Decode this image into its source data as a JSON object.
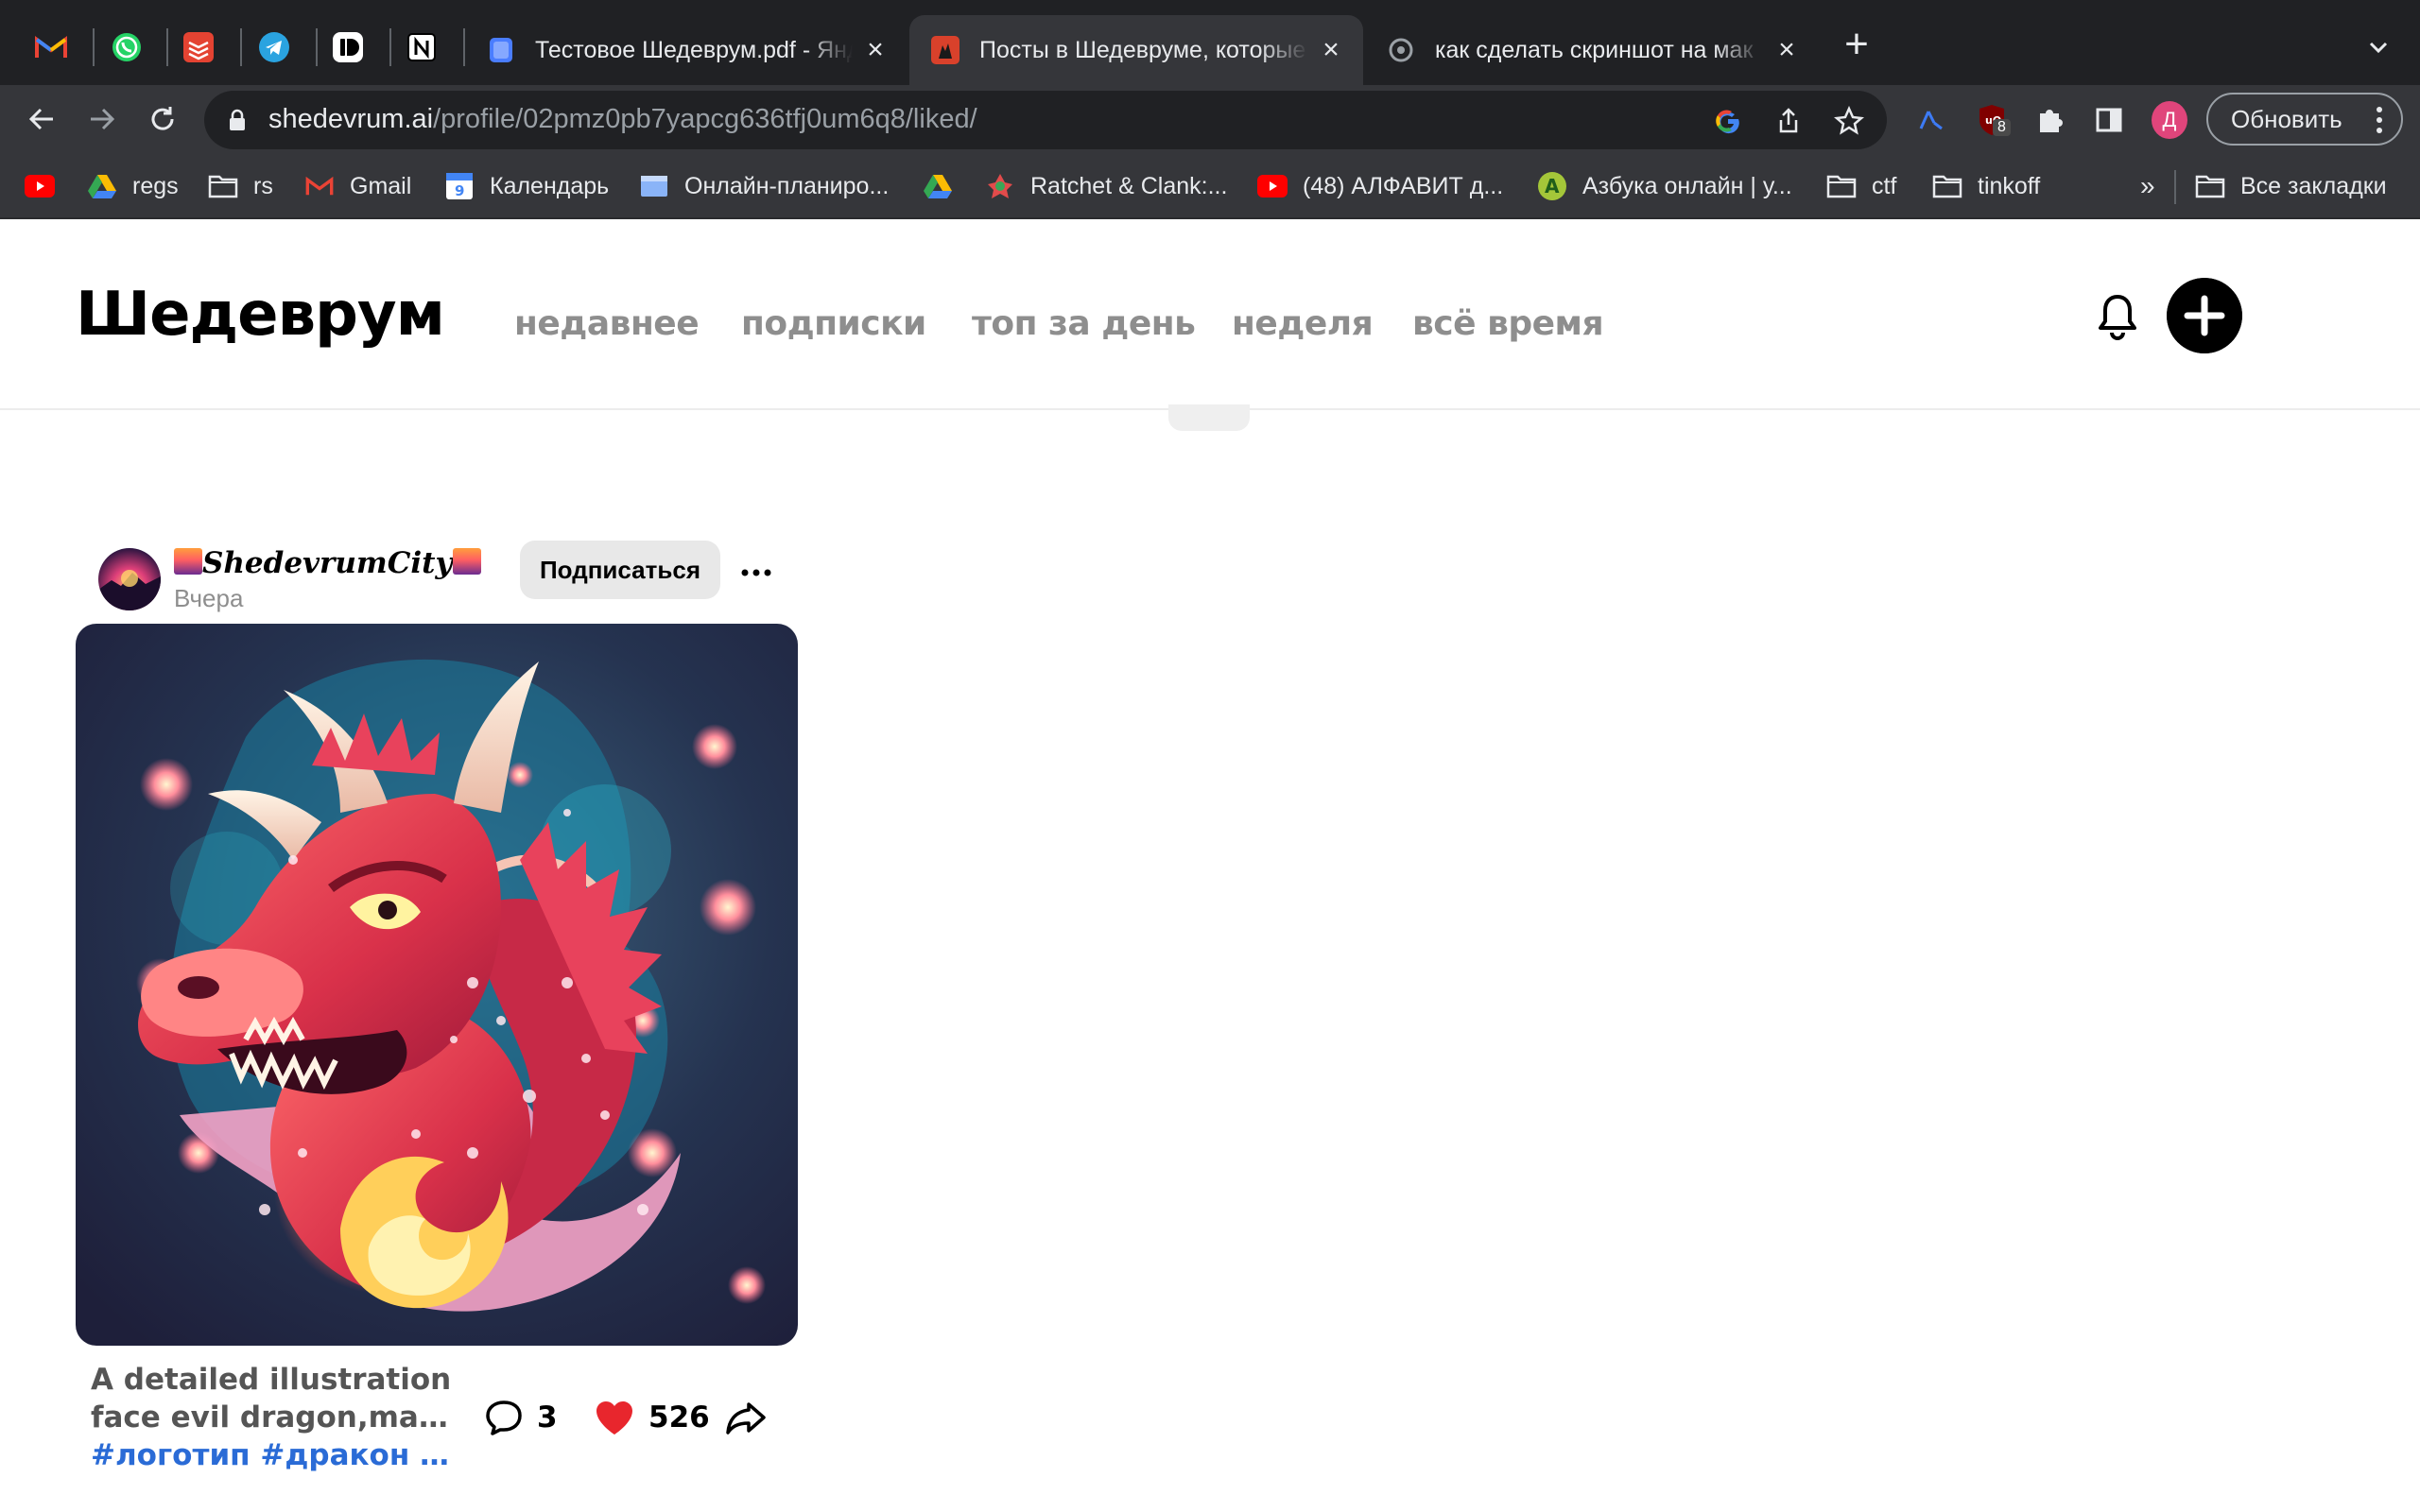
{
  "browser": {
    "pinned_tabs": [
      {
        "name": "gmail",
        "letter": "M"
      },
      {
        "name": "whatsapp",
        "letter": ""
      },
      {
        "name": "todoist",
        "letter": ""
      },
      {
        "name": "telegram",
        "letter": ""
      },
      {
        "name": "bear",
        "letter": ""
      },
      {
        "name": "notion",
        "letter": "N"
      }
    ],
    "tabs": [
      {
        "title": "Тестовое Шедеврум.pdf - Яндекс",
        "close": "×",
        "active": false
      },
      {
        "title": "Посты в Шедевруме, которые",
        "close": "×",
        "active": true
      },
      {
        "title": "как сделать скриншот на мак",
        "close": "×",
        "active": false
      }
    ],
    "new_tab": "+",
    "url_host": "shedevrum.ai",
    "url_path": "/profile/02pmz0pb7yapcg636tfj0um6q8/liked/",
    "update_label": "Обновить",
    "profile_letter": "Д",
    "extension_badge": "8",
    "bookmarks": [
      {
        "label": "",
        "icon": "youtube-icon"
      },
      {
        "label": "regs",
        "icon": "drive-icon"
      },
      {
        "label": "rs",
        "icon": "folder-icon"
      },
      {
        "label": "Gmail",
        "icon": "gmail-icon"
      },
      {
        "label": "Календарь",
        "icon": "calendar-icon"
      },
      {
        "label": "Онлайн-планиро...",
        "icon": "planner-icon"
      },
      {
        "label": "",
        "icon": "drive-icon"
      },
      {
        "label": "Ratchet & Clank:...",
        "icon": "game-icon"
      },
      {
        "label": "(48) АЛФАВИТ д...",
        "icon": "youtube-icon"
      },
      {
        "label": "Азбука онлайн | у...",
        "icon": "azbuka-icon"
      },
      {
        "label": "ctf",
        "icon": "folder-icon"
      },
      {
        "label": "tinkoff",
        "icon": "folder-icon"
      }
    ],
    "bookmarks_overflow": "»",
    "all_bookmarks": "Все закладки",
    "calendar_day": "9"
  },
  "site": {
    "logo": "Шедеврум",
    "nav": [
      "недавнее",
      "подписки",
      "топ за день",
      "неделя",
      "всё время"
    ]
  },
  "post": {
    "author": "ShedevrumCity",
    "date": "Вчера",
    "subscribe_label": "Подписаться",
    "caption_line1": "A detailed illustration",
    "caption_line2": "face evil dragon,magi...",
    "caption_tags": "#логотип #дракон #...",
    "comments": "3",
    "likes": "526"
  },
  "colors": {
    "accent_like": "#e8262d",
    "tag_link": "#2a6bd6",
    "nav_inactive": "#8e8e8e"
  }
}
